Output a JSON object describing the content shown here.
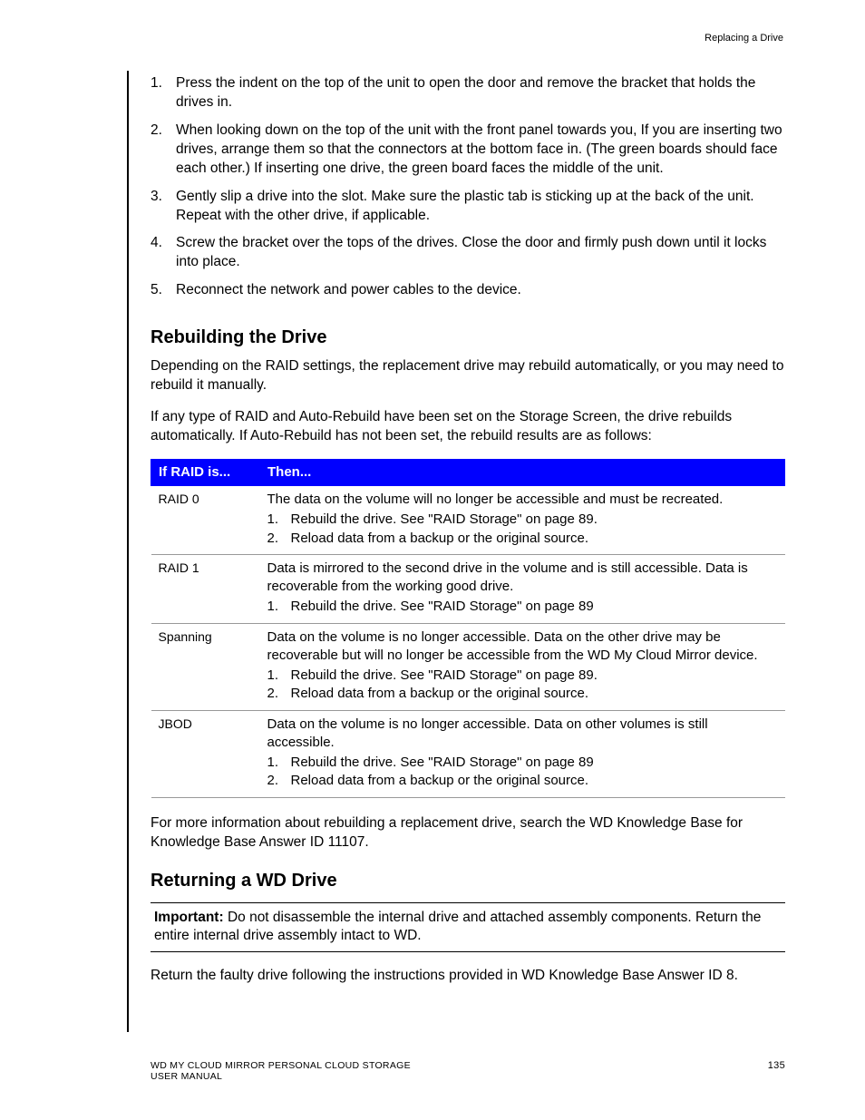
{
  "header_label": "Replacing a Drive",
  "steps": [
    "Press the indent on the top of the unit to open the door and remove the bracket that holds the drives in.",
    "When looking down on the top of the unit with the front panel towards you, If you are inserting two drives, arrange them so that the connectors at the bottom face in. (The green boards should face each other.) If inserting one drive, the green board faces the middle of the unit.",
    "Gently slip a drive into the slot. Make sure the plastic tab is sticking up at the back of the unit. Repeat with the other drive, if applicable.",
    "Screw the bracket over the tops of the drives. Close the door and firmly push down until it locks into place.",
    "Reconnect the network and power cables to the device."
  ],
  "section1_title": "Rebuilding the Drive",
  "section1_para1": "Depending on the RAID settings, the replacement drive may rebuild automatically, or you may need to rebuild it manually.",
  "section1_para2": "If any type of RAID and Auto-Rebuild have been set on the Storage Screen, the drive rebuilds automatically. If Auto-Rebuild has not been set, the rebuild results are as follows:",
  "table": {
    "h1": "If RAID is...",
    "h2": "Then...",
    "rows": [
      {
        "raid": "RAID 0",
        "intro": "The data on the volume will no longer be accessible and must be recreated.",
        "items": [
          "Rebuild the drive. See \"RAID Storage\" on page 89.",
          "Reload data from a backup or the original source."
        ]
      },
      {
        "raid": "RAID 1",
        "intro": "Data is mirrored to the second drive in the volume and is still accessible. Data is recoverable from the working good drive.",
        "items": [
          "Rebuild the drive. See \"RAID Storage\" on page 89"
        ]
      },
      {
        "raid": "Spanning",
        "intro": "Data on the volume is no longer accessible. Data on the other drive may be recoverable but will no longer be accessible from the WD My Cloud Mirror device.",
        "items": [
          "Rebuild the drive. See \"RAID Storage\" on page 89.",
          "Reload data from a backup or the original source."
        ]
      },
      {
        "raid": "JBOD",
        "intro": "Data on the volume is no longer accessible. Data on other volumes is still accessible.",
        "items": [
          "Rebuild the drive. See \"RAID Storage\" on page 89",
          "Reload data from a backup or the original source."
        ]
      }
    ]
  },
  "section1_para3": "For more information about rebuilding a replacement drive, search the WD Knowledge Base for Knowledge Base Answer ID 11107.",
  "section2_title": "Returning a WD Drive",
  "important_label": "Important:",
  "important_text": " Do not disassemble the internal drive and attached assembly components. Return the entire internal drive assembly intact to WD.",
  "section2_para1": "Return the faulty drive following the instructions provided in WD Knowledge Base Answer ID 8.",
  "footer_product": "WD MY CLOUD MIRROR PERSONAL CLOUD STORAGE",
  "footer_manual": "USER MANUAL",
  "page_number": "135"
}
